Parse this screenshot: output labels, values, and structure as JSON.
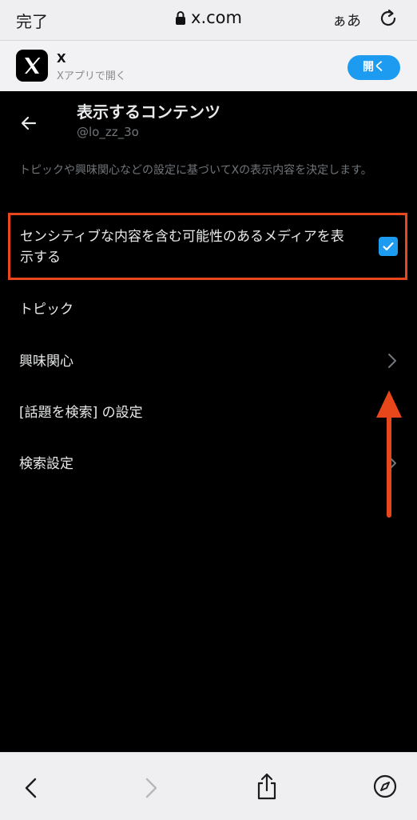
{
  "browser": {
    "done_label": "完了",
    "url": "x.com",
    "text_size_label": "ぁあ",
    "icons": {
      "lock": "lock-icon",
      "reload": "reload-icon"
    }
  },
  "app_banner": {
    "app_name": "X",
    "subtitle": "Xアプリで開く",
    "open_label": "開く",
    "icon": "x-logo-icon",
    "accent": "#1d9bf0"
  },
  "header": {
    "title": "表示するコンテンツ",
    "handle": "@lo_zz_3o",
    "back_icon": "arrow-left-icon"
  },
  "description": "トピックや興味関心などの設定に基づいてXの表示内容を決定します。",
  "sensitive_media": {
    "label": "センシティブな内容を含む可能性のあるメディアを表示する",
    "checked": true,
    "highlight_color": "#e8471b"
  },
  "menu_items": [
    {
      "label": "トピック",
      "icon": "chevron-right-icon"
    },
    {
      "label": "興味関心",
      "icon": "chevron-right-icon"
    },
    {
      "label": "[話題を検索] の設定",
      "icon": "chevron-right-icon"
    },
    {
      "label": "検索設定",
      "icon": "chevron-right-icon"
    }
  ],
  "toolbar": {
    "icons": [
      "chevron-left-icon",
      "chevron-right-icon",
      "share-icon",
      "compass-icon"
    ]
  },
  "colors": {
    "background": "#000000",
    "text_primary": "#e7e9ea",
    "text_secondary": "#71767b",
    "annotation": "#e8471b"
  }
}
